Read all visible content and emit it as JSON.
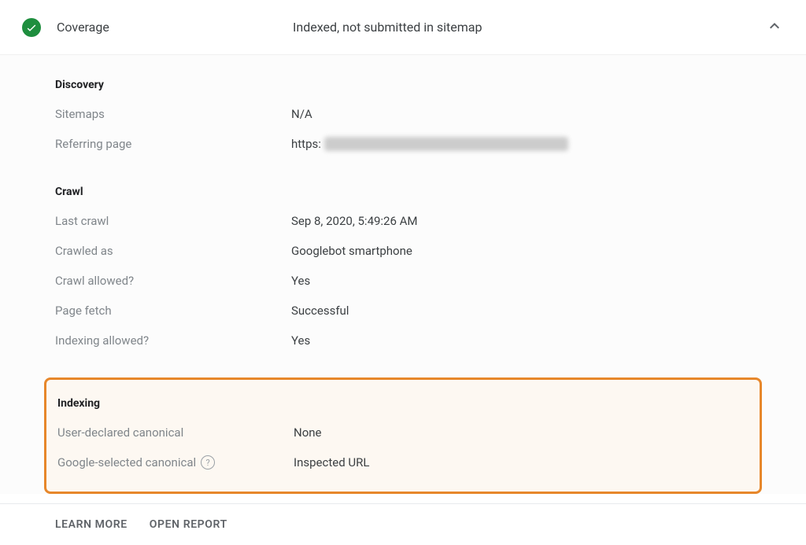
{
  "header": {
    "title": "Coverage",
    "status": "Indexed, not submitted in sitemap"
  },
  "discovery": {
    "heading": "Discovery",
    "sitemaps_label": "Sitemaps",
    "sitemaps_value": "N/A",
    "referring_label": "Referring page",
    "referring_prefix": "https:"
  },
  "crawl": {
    "heading": "Crawl",
    "last_crawl_label": "Last crawl",
    "last_crawl_value": "Sep 8, 2020, 5:49:26 AM",
    "crawled_as_label": "Crawled as",
    "crawled_as_value": "Googlebot smartphone",
    "crawl_allowed_label": "Crawl allowed?",
    "crawl_allowed_value": "Yes",
    "page_fetch_label": "Page fetch",
    "page_fetch_value": "Successful",
    "indexing_allowed_label": "Indexing allowed?",
    "indexing_allowed_value": "Yes"
  },
  "indexing": {
    "heading": "Indexing",
    "user_canonical_label": "User-declared canonical",
    "user_canonical_value": "None",
    "google_canonical_label": "Google-selected canonical",
    "google_canonical_value": "Inspected URL"
  },
  "footer": {
    "learn_more": "LEARN MORE",
    "open_report": "OPEN REPORT"
  }
}
